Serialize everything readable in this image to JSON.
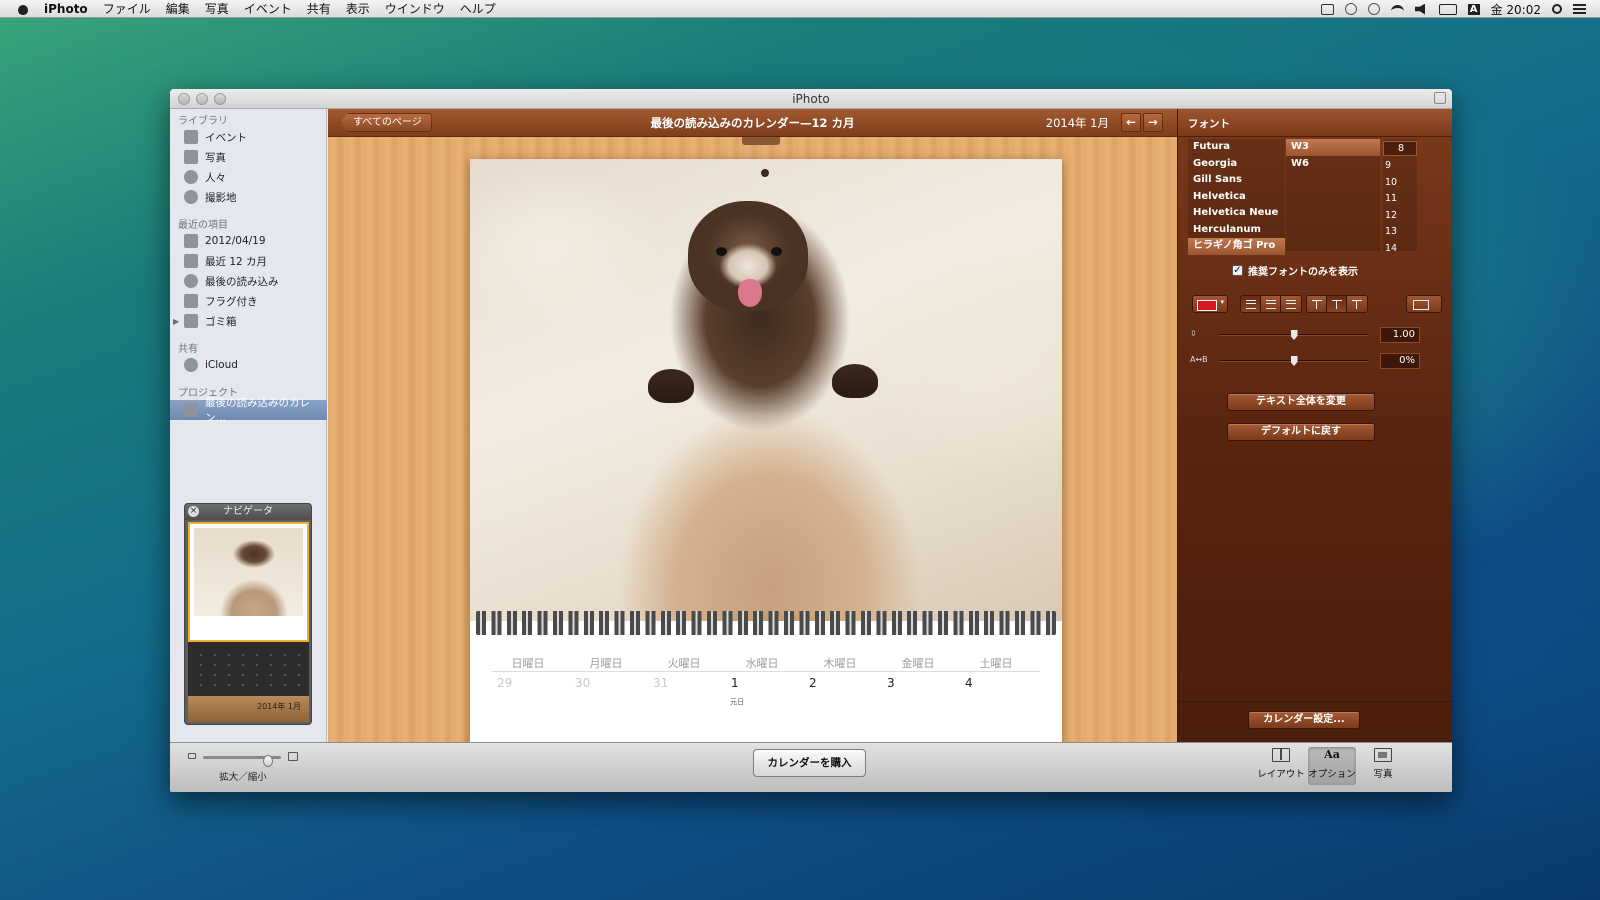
{
  "menubar": {
    "app_name": "iPhoto",
    "menus": [
      "ファイル",
      "編集",
      "写真",
      "イベント",
      "共有",
      "表示",
      "ウインドウ",
      "ヘルプ"
    ],
    "clock": "金 20:02",
    "input_mode": "A"
  },
  "window": {
    "title": "iPhoto"
  },
  "sidebar": {
    "library_header": "ライブラリ",
    "library_items": [
      "イベント",
      "写真",
      "人々",
      "撮影地"
    ],
    "recent_header": "最近の項目",
    "recent_items": [
      "2012/04/19",
      "最近 12 カ月",
      "最後の読み込み",
      "フラグ付き",
      "ゴミ箱"
    ],
    "shared_header": "共有",
    "shared_items": [
      "iCloud"
    ],
    "projects_header": "プロジェクト",
    "project_items": [
      "最後の読み込みのカレン…"
    ]
  },
  "navigator": {
    "title": "ナビゲータ",
    "footer_date": "2014年 1月"
  },
  "center": {
    "back_button": "すべてのページ",
    "title": "最後の読み込みのカレンダー—12 カ月",
    "date_label": "2014年 1月",
    "prev_arrow": "←",
    "next_arrow": "→"
  },
  "calendar": {
    "weekdays": [
      "日曜日",
      "月曜日",
      "火曜日",
      "水曜日",
      "木曜日",
      "金曜日",
      "土曜日"
    ],
    "days": [
      "29",
      "30",
      "31",
      "1",
      "2",
      "3",
      "4"
    ],
    "holiday_note": "元日"
  },
  "inspector": {
    "header": "フォント",
    "fonts": [
      "Futura",
      "Georgia",
      "Gill Sans",
      "Helvetica",
      "Helvetica Neue",
      "Herculanum",
      "ヒラギノ角ゴ Pro"
    ],
    "weights": [
      "W3",
      "W6"
    ],
    "sizes": [
      "8",
      "9",
      "10",
      "11",
      "12",
      "13",
      "14"
    ],
    "recommended_only_label": "推奨フォントのみを表示",
    "line_spacing_value": "1.00",
    "char_spacing_label": "A↔B",
    "char_spacing_value": "0%",
    "line_spacing_level": 0.5,
    "char_spacing_level": 0.5,
    "change_all_button": "テキスト全体を変更",
    "reset_button": "デフォルトに戻す",
    "calendar_settings_button": "カレンダー設定...",
    "text_color": "#d8171c"
  },
  "bottombar": {
    "zoom_label": "拡大／縮小",
    "buy_button": "カレンダーを購入",
    "layout_label": "レイアウト",
    "options_label": "オプション",
    "photos_label": "写真"
  }
}
